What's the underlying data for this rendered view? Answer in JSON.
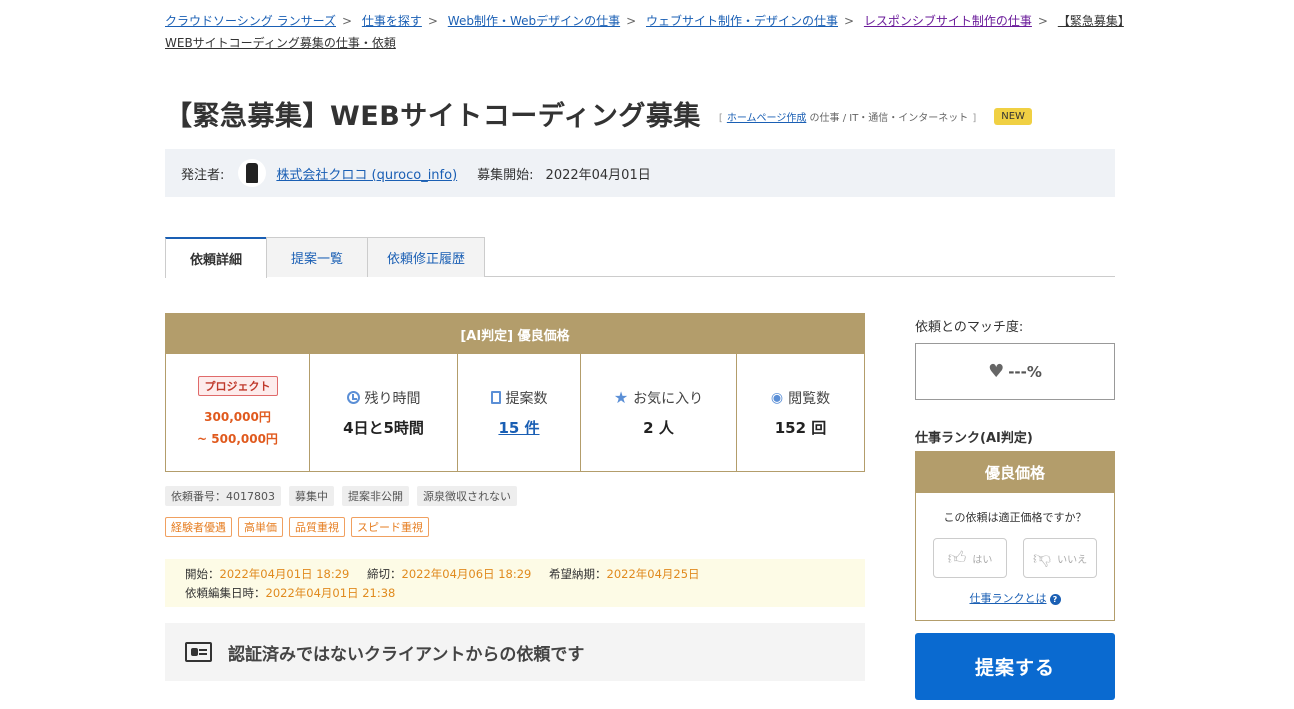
{
  "breadcrumb": [
    {
      "label": "クラウドソーシング ランサーズ"
    },
    {
      "label": "仕事を探す"
    },
    {
      "label": "Web制作・Webデザインの仕事"
    },
    {
      "label": "ウェブサイト制作・デザインの仕事"
    },
    {
      "label": "レスポンシブサイト制作の仕事"
    },
    {
      "label": "【緊急募集】WEBサイトコーディング募集の仕事・依頼"
    }
  ],
  "job": {
    "title": "【緊急募集】WEBサイトコーディング募集",
    "category_open": "[",
    "category_link": "ホームページ作成",
    "category_rest": "の仕事 / IT・通信・インターネット",
    "category_close": "]",
    "new_badge": "NEW"
  },
  "client": {
    "label": "発注者:",
    "name": "株式会社クロコ (quroco_info)",
    "start_label": "募集開始:",
    "start_date": "2022年04月01日"
  },
  "tabs": [
    {
      "label": "依頼詳細",
      "active": true
    },
    {
      "label": "提案一覧",
      "active": false
    },
    {
      "label": "依頼修正履歴",
      "active": false
    }
  ],
  "price": {
    "header": "[AI判定] 優良価格",
    "type_badge": "プロジェクト",
    "budget_min": "300,000円",
    "budget_max": "~ 500,000円",
    "remaining_label": "残り時間",
    "remaining_value": "4日と5時間",
    "proposals_label": "提案数",
    "proposals_value": "15 件",
    "favorites_label": "お気に入り",
    "favorites_value": "2 人",
    "views_label": "閲覧数",
    "views_value": "152 回"
  },
  "tags": [
    "依頼番号：4017803",
    "募集中",
    "提案非公開",
    "源泉徴収されない"
  ],
  "feature_tags": [
    "経験者優遇",
    "高単価",
    "品質重視",
    "スピード重視"
  ],
  "dates": {
    "start_label": "開始：",
    "start_value": "2022年04月01日 18:29",
    "deadline_label": "締切：",
    "deadline_value": "2022年04月06日 18:29",
    "delivery_label": "希望納期：",
    "delivery_value": "2022年04月25日",
    "edited_label": "依頼編集日時：",
    "edited_value": "2022年04月01日 21:38"
  },
  "notice": {
    "text": "認証済みではないクライアントからの依頼です",
    "icon": "id-card-icon"
  },
  "sidebar": {
    "match_label": "依頼とのマッチ度:",
    "match_value": "---%",
    "rank_label": "仕事ランク(AI判定)",
    "rank_header": "優良価格",
    "rank_question": "この依頼は適正価格ですか？",
    "vote_yes": "はい",
    "vote_no": "いいえ",
    "rank_link": "仕事ランクとは",
    "propose_button": "提案する"
  },
  "colors": {
    "gold": "#b39d6b",
    "link": "#1a5fb4",
    "primary_button": "#0a6ad0",
    "budget": "#e05a1e"
  }
}
